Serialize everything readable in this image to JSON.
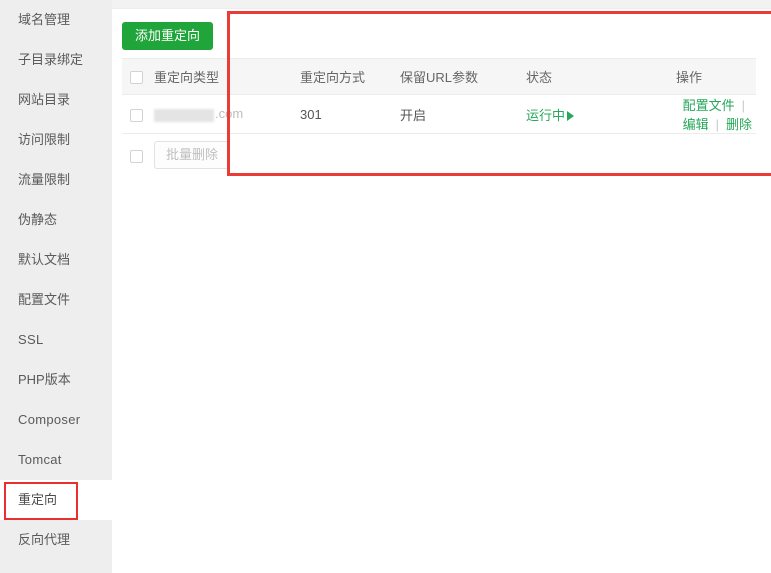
{
  "sidebar": {
    "items": [
      {
        "label": "域名管理",
        "active": false,
        "latin": false
      },
      {
        "label": "子目录绑定",
        "active": false,
        "latin": false
      },
      {
        "label": "网站目录",
        "active": false,
        "latin": false
      },
      {
        "label": "访问限制",
        "active": false,
        "latin": false
      },
      {
        "label": "流量限制",
        "active": false,
        "latin": false
      },
      {
        "label": "伪静态",
        "active": false,
        "latin": false
      },
      {
        "label": "默认文档",
        "active": false,
        "latin": false
      },
      {
        "label": "配置文件",
        "active": false,
        "latin": false
      },
      {
        "label": "SSL",
        "active": false,
        "latin": true
      },
      {
        "label": "PHP版本",
        "active": false,
        "latin": false
      },
      {
        "label": "Composer",
        "active": false,
        "latin": true
      },
      {
        "label": "Tomcat",
        "active": false,
        "latin": true
      },
      {
        "label": "重定向",
        "active": true,
        "latin": false
      },
      {
        "label": "反向代理",
        "active": false,
        "latin": false
      }
    ]
  },
  "toolbar": {
    "add_label": "添加重定向"
  },
  "table": {
    "headers": {
      "checkbox": "select-all",
      "type": "重定向类型",
      "mode": "重定向方式",
      "keep_url": "保留URL参数",
      "status": "状态",
      "operations": "操作"
    },
    "rows": [
      {
        "domain_redacted": true,
        "domain_suffix": ".com",
        "mode": "301",
        "keep_url": "开启",
        "status": "运行中",
        "status_icon": "play-triangle-icon",
        "ops": [
          {
            "label": "配置文件"
          },
          {
            "label": "编辑"
          },
          {
            "label": "删除"
          }
        ],
        "op_separator": "|"
      }
    ]
  },
  "footer": {
    "batch_delete_label": "批量删除"
  },
  "annotations": {
    "panel_box_color": "#ea3b36",
    "nav_box_color": "#e8302f"
  },
  "colors": {
    "primary_green": "#20a53a",
    "link_green": "#26a75a",
    "sidebar_bg": "#eeeeee",
    "header_bg": "#f6f6f6"
  }
}
